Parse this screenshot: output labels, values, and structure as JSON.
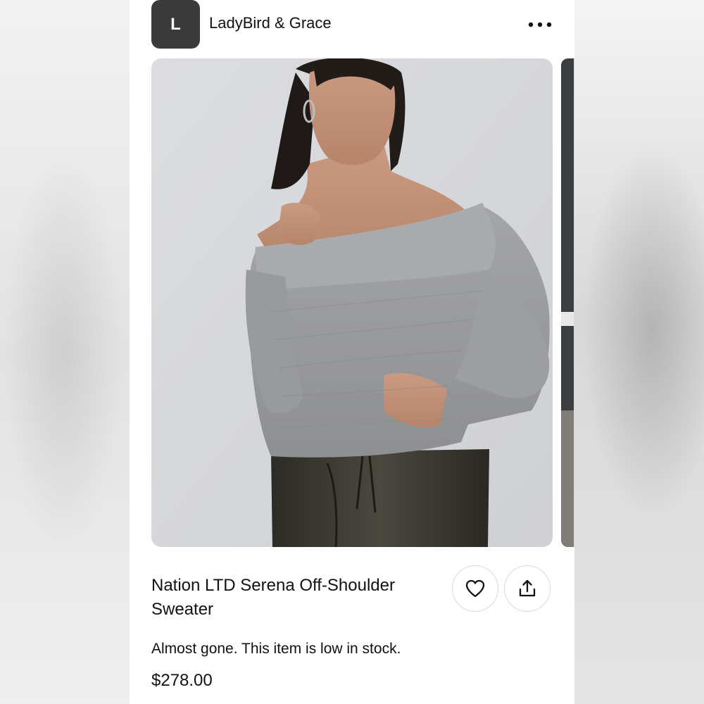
{
  "shop": {
    "avatar_letter": "L",
    "name": "LadyBird & Grace"
  },
  "header": {
    "more_icon": "more-horizontal-icon"
  },
  "product": {
    "title": "Nation LTD Serena Off-Shoulder Sweater",
    "stock_message": "Almost gone. This item is low in stock.",
    "price": "$278.00",
    "image_alt": "Model wearing grey off-shoulder knit sweater with dark pants",
    "favorite_icon": "heart-icon",
    "share_icon": "share-icon"
  },
  "colors": {
    "avatar_bg": "#3a3a3a",
    "text": "#111111",
    "sweater": "#9a9b9d",
    "backdrop": "#d9dadc"
  }
}
